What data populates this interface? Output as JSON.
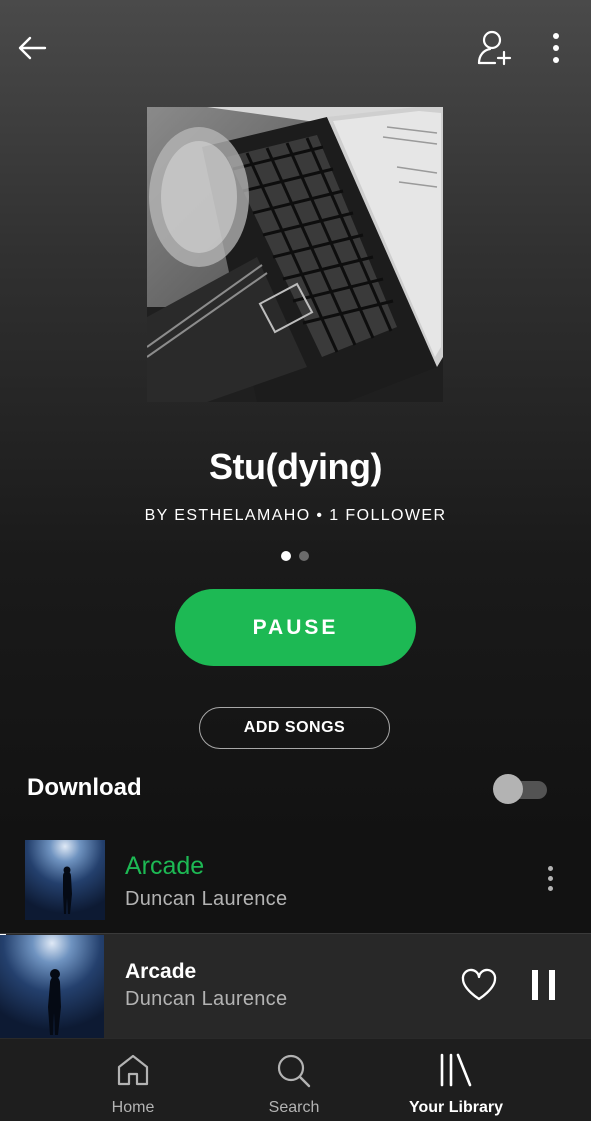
{
  "playlist": {
    "title": "Stu(dying)",
    "byline": "BY ESTHELAMAHO • 1 FOLLOWER",
    "page_indicator": {
      "count": 2,
      "active": 1
    },
    "pause_label": "PAUSE",
    "add_songs_label": "ADD SONGS",
    "download_label": "Download",
    "download_enabled": false
  },
  "tracks": [
    {
      "title": "Arcade",
      "artist": "Duncan Laurence",
      "playing": true
    }
  ],
  "mini_player": {
    "title": "Arcade",
    "artist": "Duncan Laurence",
    "progress": 0.01,
    "liked": false
  },
  "nav": {
    "items": [
      {
        "label": "Home",
        "icon": "home-icon",
        "active": false
      },
      {
        "label": "Search",
        "icon": "search-icon",
        "active": false
      },
      {
        "label": "Your Library",
        "icon": "library-icon",
        "active": true
      }
    ]
  },
  "colors": {
    "accent": "#1db954",
    "background": "#121212",
    "mini_player_bg": "#282828",
    "secondary_text": "#b3b3b3"
  }
}
